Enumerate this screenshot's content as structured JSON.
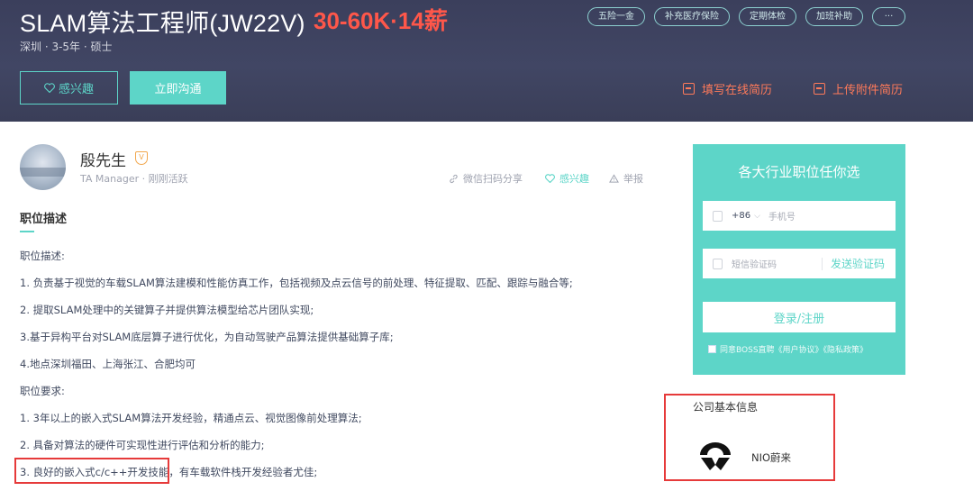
{
  "job": {
    "title": "SLAM算法工程师(JW22V)",
    "salary": "30-60K·14薪",
    "meta": "深圳 · 3-5年 · 硕士",
    "tags": [
      "五险一金",
      "补充医疗保险",
      "定期体检",
      "加班补助",
      "···"
    ]
  },
  "actions": {
    "interest_label": "感兴趣",
    "chat_label": "立即沟通",
    "resume_online": "填写在线简历",
    "resume_upload": "上传附件简历"
  },
  "recruiter": {
    "name": "殷先生",
    "verify_mark": "V",
    "role": "TA Manager · 刚刚活跃",
    "share": "微信扫码分享",
    "favorite": "感兴趣",
    "report": "举报"
  },
  "description": {
    "section_title": "职位描述",
    "lines": [
      "职位描述:",
      "1. 负责基于视觉的车载SLAM算法建模和性能仿真工作，包括视频及点云信号的前处理、特征提取、匹配、跟踪与融合等;",
      "2. 提取SLAM处理中的关键算子并提供算法模型给芯片团队实现;",
      "3.基于异构平台对SLAM底层算子进行优化，为自动驾驶产品算法提供基础算子库;",
      "4.地点深圳福田、上海张江、合肥均可",
      "职位要求:",
      "1. 3年以上的嵌入式SLAM算法开发经验，精通点云、视觉图像前处理算法;",
      "2. 具备对算法的硬件可实现性进行评估和分析的能力;",
      "3. 良好的嵌入式c/c++开发技能，有车载软件栈开发经验者尤佳;"
    ]
  },
  "login": {
    "title": "各大行业职位任你选",
    "country_code": "+86",
    "phone_placeholder": "手机号",
    "code_placeholder": "短信验证码",
    "send_code": "发送验证码",
    "submit": "登录/注册",
    "agreement": "同意BOSS直聘《用户协议》《隐私政策》"
  },
  "company": {
    "section_title": "公司基本信息",
    "name": "NIO蔚来"
  },
  "colors": {
    "accent": "#5dd5c8",
    "salary": "#fe574a",
    "resume_link": "#fe7a5a",
    "annotation_red": "#e63a3a",
    "header_bg": "#3f435f"
  }
}
